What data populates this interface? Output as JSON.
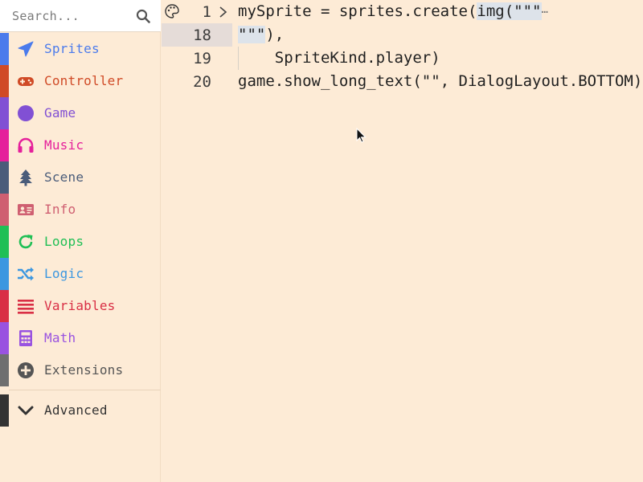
{
  "search": {
    "placeholder": "Search..."
  },
  "toolbox": {
    "categories": [
      {
        "label": "Sprites",
        "color": "#4b7bec",
        "icon": "paper-plane-icon"
      },
      {
        "label": "Controller",
        "color": "#d04a26",
        "icon": "gamepad-icon"
      },
      {
        "label": "Game",
        "color": "#8150d4",
        "icon": "circle-icon"
      },
      {
        "label": "Music",
        "color": "#e5209b",
        "icon": "headphones-icon"
      },
      {
        "label": "Scene",
        "color": "#4a5c7a",
        "icon": "tree-icon"
      },
      {
        "label": "Info",
        "color": "#cf5f71",
        "icon": "id-card-icon"
      },
      {
        "label": "Loops",
        "color": "#20bf55",
        "icon": "refresh-icon"
      },
      {
        "label": "Logic",
        "color": "#3c97e0",
        "icon": "shuffle-icon"
      },
      {
        "label": "Variables",
        "color": "#d92f45",
        "icon": "list-icon"
      },
      {
        "label": "Math",
        "color": "#9952e0",
        "icon": "calculator-icon"
      },
      {
        "label": "Extensions",
        "color": "#6f6f6f",
        "icon": "plus-circle-icon"
      }
    ],
    "advanced": {
      "label": "Advanced",
      "color": "#333333",
      "icon": "chevron-down-icon"
    }
  },
  "editor": {
    "lines": [
      {
        "number": "1",
        "code_before": "mySprite = sprites.create(",
        "code_sel": "img(\"\"\"",
        "ellipsis": "…"
      },
      {
        "number": "18",
        "code_sel": "\"\"\"",
        "code_after": "),"
      },
      {
        "number": "19",
        "code": "    SpriteKind.player)"
      },
      {
        "number": "20",
        "code": "game.show_long_text(\"\", DialogLayout.BOTTOM)"
      }
    ]
  }
}
